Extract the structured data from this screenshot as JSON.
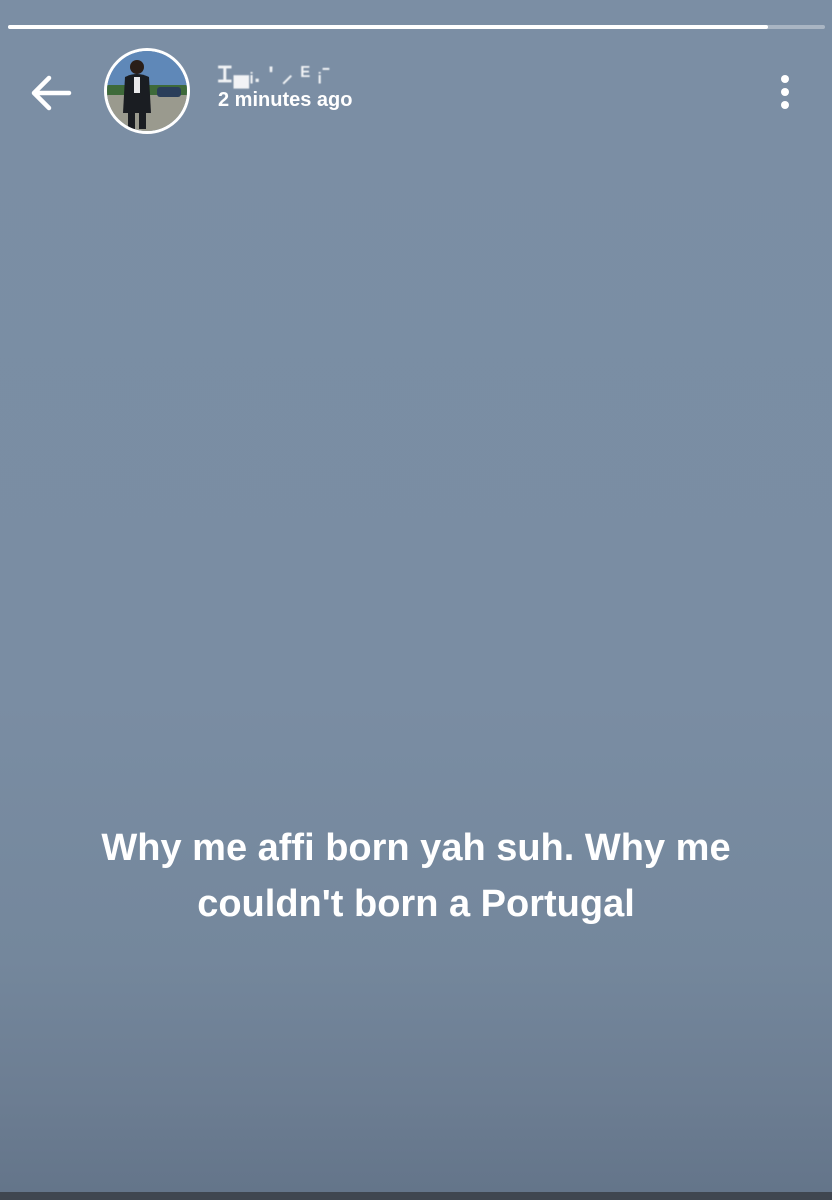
{
  "story": {
    "progress_fraction": 0.93,
    "background_color": "#7b8ea4"
  },
  "header": {
    "back_icon": "arrow-left-icon",
    "avatar_icon": "profile-photo",
    "username": "Ꮖ▄ᵢ. ' ⸝ ᴱ ᵢ⁻",
    "timestamp": "2 minutes ago",
    "menu_icon": "more-vertical-icon"
  },
  "status": {
    "text": "Why me affi born yah suh. Why me couldn't born a Portugal"
  }
}
